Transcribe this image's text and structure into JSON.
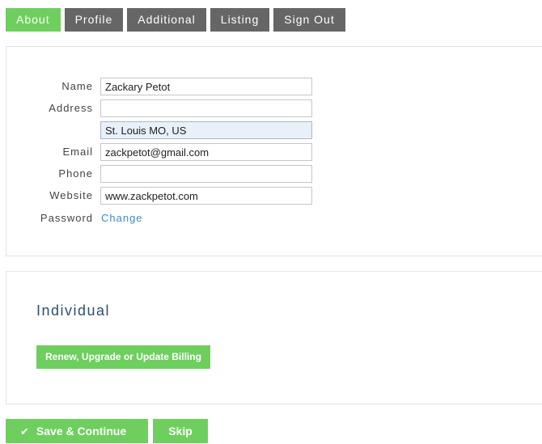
{
  "tabs": [
    {
      "label": "About",
      "active": true
    },
    {
      "label": "Profile",
      "active": false
    },
    {
      "label": "Additional",
      "active": false
    },
    {
      "label": "Listing",
      "active": false
    },
    {
      "label": "Sign Out",
      "active": false
    }
  ],
  "about": {
    "name": {
      "label": "Name",
      "value": "Zackary Petot"
    },
    "address": {
      "label": "Address",
      "line1": "",
      "line2": "St. Louis MO, US"
    },
    "email": {
      "label": "Email",
      "value": "zackpetot@gmail.com"
    },
    "phone": {
      "label": "Phone",
      "value": ""
    },
    "website": {
      "label": "Website",
      "value": "www.zackpetot.com"
    },
    "password": {
      "label": "Password",
      "link": "Change"
    }
  },
  "plan": {
    "title": "Individual",
    "billing_button": "Renew, Upgrade or Update Billing"
  },
  "footer": {
    "save_label": "Save & Continue",
    "skip_label": "Skip",
    "check_icon": "✔"
  },
  "colors": {
    "accent": "#6ecf5e",
    "tab_inactive": "#666666",
    "link": "#3b8ec2",
    "heading": "#2e4f73"
  }
}
